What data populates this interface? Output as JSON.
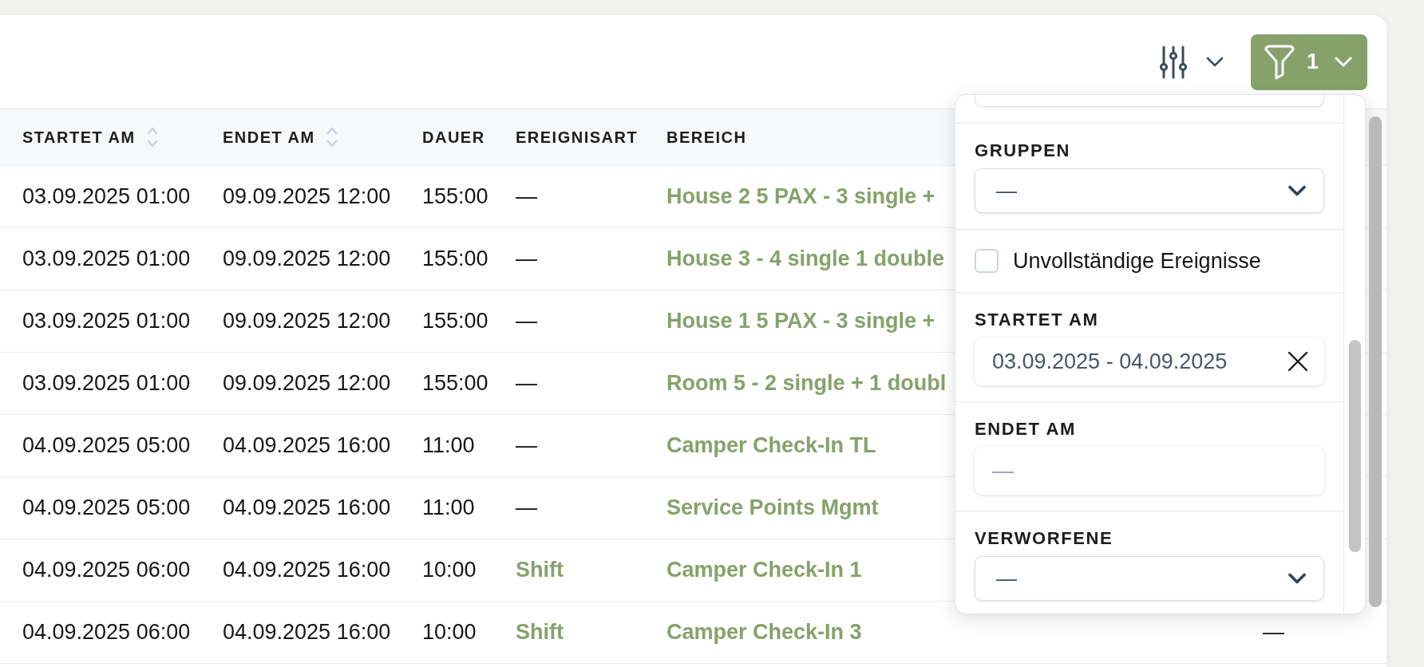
{
  "toolbar": {
    "filter_button": {
      "count": "1"
    }
  },
  "table": {
    "columns": [
      {
        "label": "STARTET AM",
        "sortable": true
      },
      {
        "label": "ENDET AM",
        "sortable": true
      },
      {
        "label": "DAUER",
        "sortable": false
      },
      {
        "label": "EREIGNISART",
        "sortable": false
      },
      {
        "label": "BEREICH",
        "sortable": false
      }
    ],
    "rows": [
      {
        "starts_at": "03.09.2025 01:00",
        "ends_at": "09.09.2025 12:00",
        "duration": "155:00",
        "event_type": {
          "kind": "plain",
          "text": "—"
        },
        "area": "House 2 5 PAX - 3 single +"
      },
      {
        "starts_at": "03.09.2025 01:00",
        "ends_at": "09.09.2025 12:00",
        "duration": "155:00",
        "event_type": {
          "kind": "plain",
          "text": "—"
        },
        "area": "House 3 - 4 single 1 double"
      },
      {
        "starts_at": "03.09.2025 01:00",
        "ends_at": "09.09.2025 12:00",
        "duration": "155:00",
        "event_type": {
          "kind": "plain",
          "text": "—"
        },
        "area": "House 1 5 PAX - 3 single +"
      },
      {
        "starts_at": "03.09.2025 01:00",
        "ends_at": "09.09.2025 12:00",
        "duration": "155:00",
        "event_type": {
          "kind": "plain",
          "text": "—"
        },
        "area": "Room 5 - 2 single + 1 doubl"
      },
      {
        "starts_at": "04.09.2025 05:00",
        "ends_at": "04.09.2025 16:00",
        "duration": "11:00",
        "event_type": {
          "kind": "plain",
          "text": "—"
        },
        "area": "Camper Check-In TL"
      },
      {
        "starts_at": "04.09.2025 05:00",
        "ends_at": "04.09.2025 16:00",
        "duration": "11:00",
        "event_type": {
          "kind": "plain",
          "text": "—"
        },
        "area": "Service Points Mgmt"
      },
      {
        "starts_at": "04.09.2025 06:00",
        "ends_at": "04.09.2025 16:00",
        "duration": "10:00",
        "event_type": {
          "kind": "link",
          "text": "Shift"
        },
        "area": "Camper Check-In 1"
      },
      {
        "starts_at": "04.09.2025 06:00",
        "ends_at": "04.09.2025 16:00",
        "duration": "10:00",
        "event_type": {
          "kind": "link",
          "text": "Shift"
        },
        "area": "Camper Check-In 3",
        "column_6": "—"
      }
    ]
  },
  "filter_panel": {
    "sections": [
      {
        "kind": "scrolled_field"
      },
      {
        "kind": "select",
        "label": "GRUPPEN",
        "value": "—"
      },
      {
        "kind": "checkbox",
        "label": "Unvollständige Ereignisse",
        "checked": false
      },
      {
        "kind": "date_range",
        "label": "STARTET AM",
        "value": "03.09.2025 - 04.09.2025",
        "clearable": true
      },
      {
        "kind": "date_range",
        "label": "ENDET AM",
        "placeholder": "—",
        "clearable": false
      },
      {
        "kind": "select",
        "label": "VERWORFENE",
        "value": "—"
      }
    ]
  }
}
